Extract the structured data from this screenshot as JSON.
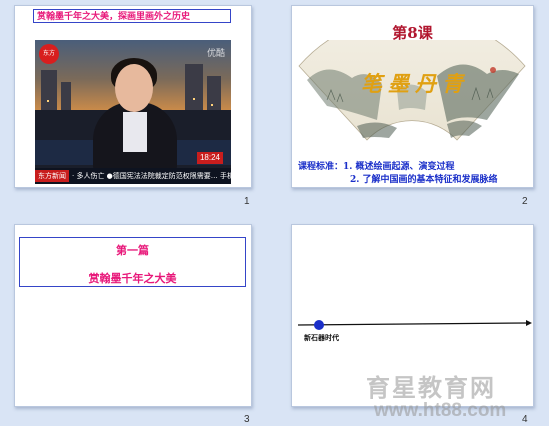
{
  "slides": [
    {
      "number": "1",
      "title": "赏翰墨千年之大美，探画里画外之历史",
      "video": {
        "watermark": "优酷",
        "logo": "东方",
        "clock": "18:24",
        "ticker_tag": "东方新闻",
        "ticker_text": "· 多人伤亡    ●德国宪法法院裁定防范权限需要…  手机日报"
      }
    },
    {
      "number": "2",
      "lesson": "第8课",
      "fan_text": "笔墨丹青",
      "standard_label": "课程标准：",
      "standard_items": [
        "1. 概述绘画起源、演变过程",
        "2. 了解中国画的基本特征和发展脉络"
      ]
    },
    {
      "number": "3",
      "part": "第一篇",
      "part_title": "赏翰墨千年之大美"
    },
    {
      "number": "4",
      "timeline_label": "新石器时代"
    }
  ],
  "site_watermark": {
    "name": "育星教育网",
    "url": "www.ht88.com"
  },
  "colors": {
    "background": "#d9e4f5",
    "pink": "#e8187a",
    "blue": "#1a2fc9",
    "lesson_red": "#b1162f",
    "gold": "#e0a012",
    "timeline_dot": "#1a2fc9"
  },
  "icons": [
    "channel-logo-icon",
    "timeline-dot-icon",
    "arrow-right-icon"
  ]
}
